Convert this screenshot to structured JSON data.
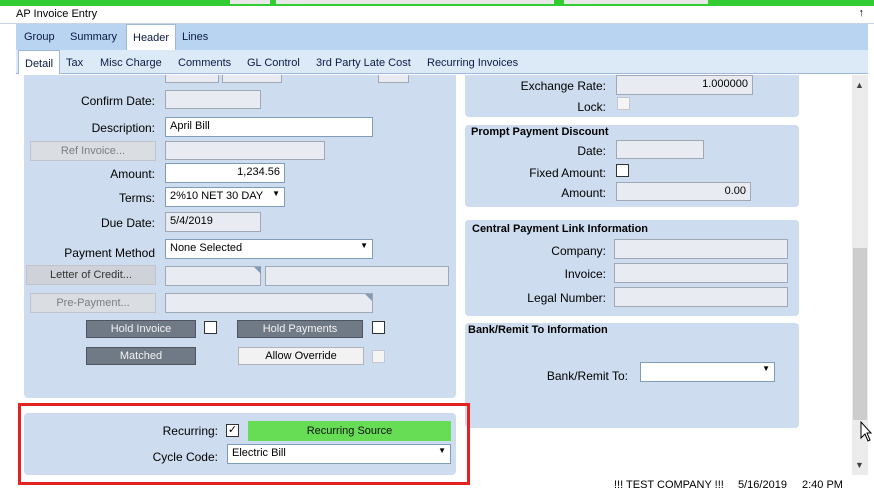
{
  "window": {
    "title": "AP Invoice Entry",
    "pin": "↑"
  },
  "tabs_top": [
    {
      "label": "Group"
    },
    {
      "label": "Summary"
    },
    {
      "label": "Header"
    },
    {
      "label": "Lines"
    }
  ],
  "tabs_sub": [
    {
      "label": "Detail"
    },
    {
      "label": "Tax"
    },
    {
      "label": "Misc Charge"
    },
    {
      "label": "Comments"
    },
    {
      "label": "GL Control"
    },
    {
      "label": "3rd Party Late Cost"
    },
    {
      "label": "Recurring Invoices"
    }
  ],
  "left": {
    "confirm_date_label": "Confirm Date:",
    "description_label": "Description:",
    "description_value": "April Bill",
    "ref_invoice_button": "Ref Invoice...",
    "amount_label": "Amount:",
    "amount_value": "1,234.56",
    "terms_label": "Terms:",
    "terms_value": "2%10 NET 30 DAY",
    "due_date_label": "Due Date:",
    "due_date_value": "5/4/2019",
    "payment_method_label": "Payment Method",
    "payment_method_value": "None Selected",
    "letter_of_credit_button": "Letter of Credit...",
    "prepayment_button": "Pre-Payment...",
    "hold_invoice_button": "Hold Invoice",
    "hold_payments_button": "Hold Payments",
    "matched_button": "Matched",
    "allow_override_button": "Allow Override"
  },
  "recurring": {
    "recurring_label": "Recurring:",
    "recurring_checked": "✓",
    "source_button": "Recurring Source",
    "cycle_code_label": "Cycle Code:",
    "cycle_code_value": "Electric Bill"
  },
  "right": {
    "exchange_rate_label": "Exchange Rate:",
    "exchange_rate_value": "1.000000",
    "lock_label": "Lock:",
    "prompt_title": "Prompt Payment Discount",
    "date_label": "Date:",
    "fixed_amount_label": "Fixed Amount:",
    "amount_label": "Amount:",
    "amount_value": "0.00",
    "central_title": "Central Payment Link Information",
    "company_label": "Company:",
    "invoice_label": "Invoice:",
    "legal_number_label": "Legal Number:",
    "bank_title": "Bank/Remit To Information",
    "bank_remit_label": "Bank/Remit To:"
  },
  "status": {
    "company": "!!! TEST COMPANY !!!",
    "date": "5/16/2019",
    "time": "2:40 PM"
  },
  "colors": {
    "accent_green": "#66dd55",
    "highlight_red": "#e52222",
    "panel_blue": "#cddcee"
  }
}
